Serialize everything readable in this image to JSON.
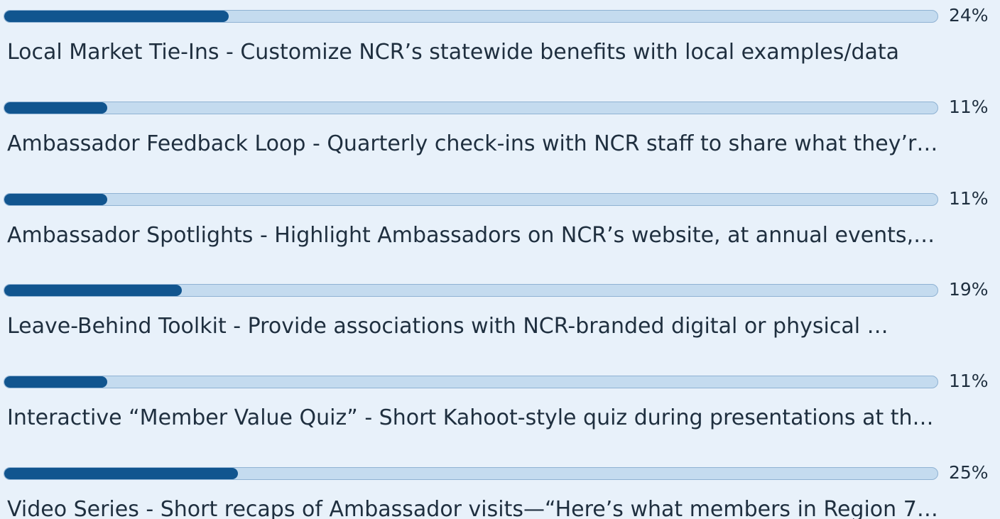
{
  "colors": {
    "background": "#e8f1fa",
    "bar_fill": "#11558f",
    "bar_track": "#c4dbef",
    "text": "#1f2f3f"
  },
  "chart_data": {
    "type": "bar",
    "orientation": "horizontal",
    "categories": [
      "Local Market Tie-Ins - Customize NCR’s statewide benefits with local examples/data",
      "Ambassador Feedback Loop - Quarterly check-ins with NCR staff to share what they’r…",
      "Ambassador Spotlights - Highlight Ambassadors on NCR’s website, at annual events,…",
      "Leave-Behind Toolkit - Provide associations with NCR-branded digital or physical …",
      "Interactive “Member Value Quiz” - Short Kahoot-style quiz during presentations at th…",
      "Video Series - Short recaps of Ambassador visits—“Here’s what members in Region 7 …"
    ],
    "values": [
      24,
      11,
      11,
      19,
      11,
      25
    ],
    "value_labels": [
      "24%",
      "11%",
      "11%",
      "19%",
      "11%",
      "25%"
    ],
    "unit": "%",
    "xlim": [
      0,
      100
    ],
    "grid": false
  }
}
